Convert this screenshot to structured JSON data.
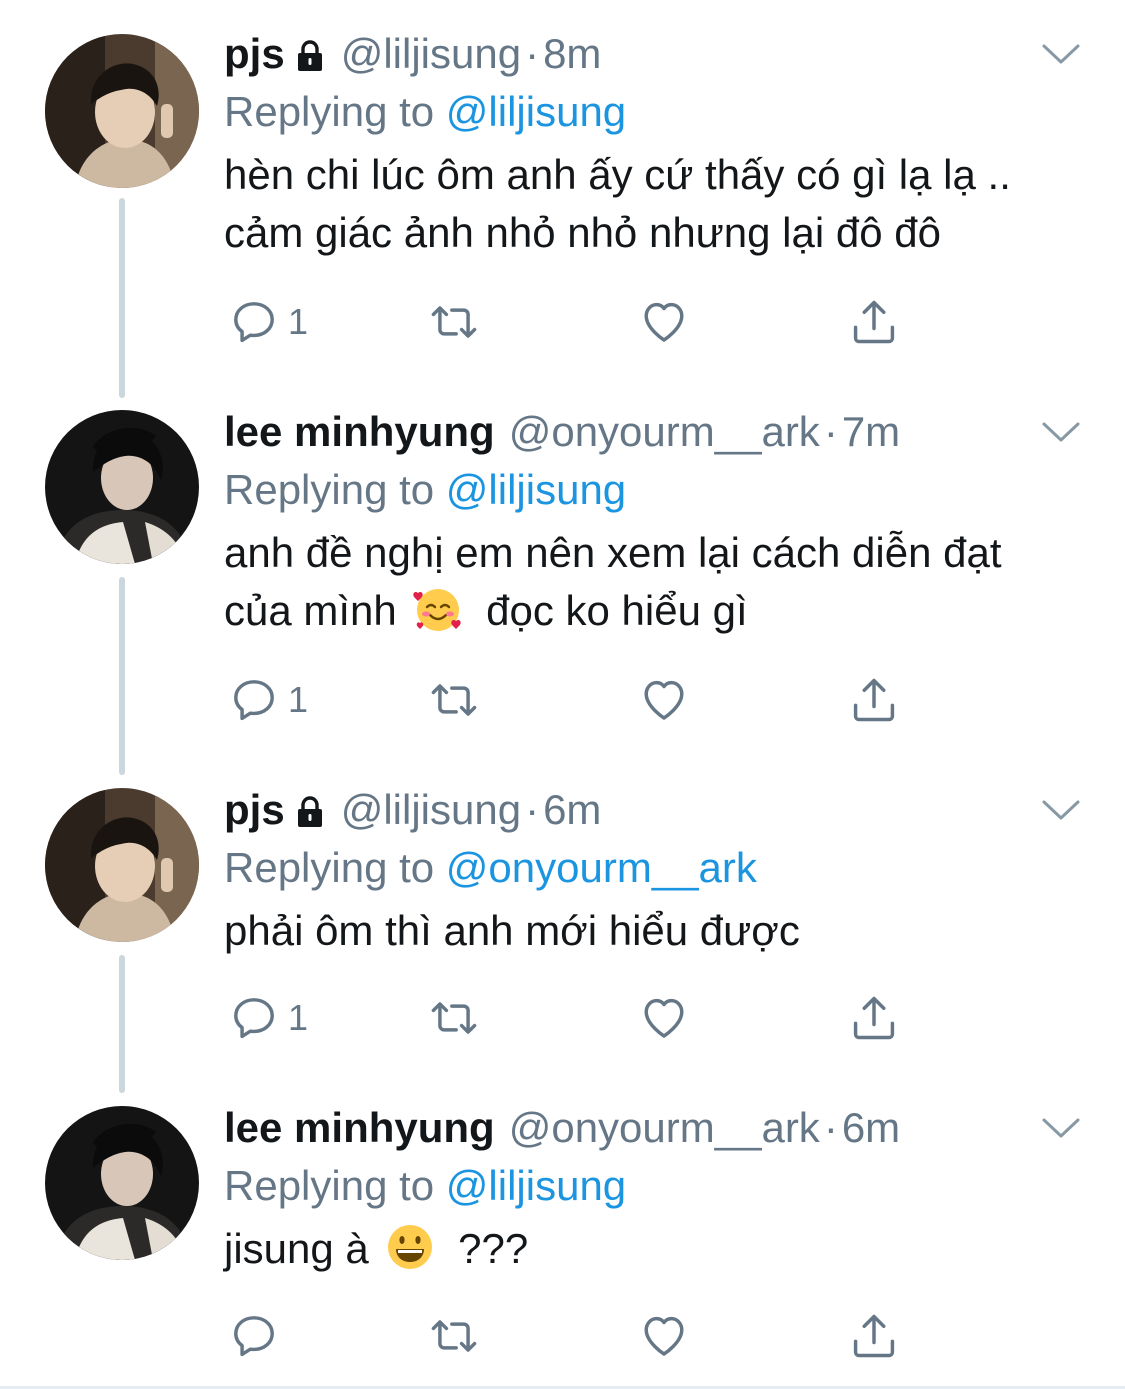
{
  "tweets": [
    {
      "name": "pjs",
      "protected": true,
      "handle": "@liljisung",
      "time": "8m",
      "replying_label": "Replying to",
      "replying_to": "@liljisung",
      "text_lines": [
        "hèn chi lúc ôm anh ấy cứ thấy có gì lạ lạ ..",
        "cảm giác ảnh nhỏ nhỏ nhưng lại đô đô"
      ],
      "reply_count": "1",
      "avatar": "avatar-pjs"
    },
    {
      "name": "lee minhyung",
      "protected": false,
      "handle": "@onyourm__ark",
      "time": "7m",
      "replying_label": "Replying to",
      "replying_to": "@liljisung",
      "text_line1": "anh đề nghị em nên xem lại cách diễn đạt",
      "text_line2_before": "của mình",
      "text_line2_emoji": "smiling-face-with-hearts",
      "text_line2_after": "đọc ko hiểu gì",
      "reply_count": "1",
      "avatar": "avatar-minhyung"
    },
    {
      "name": "pjs",
      "protected": true,
      "handle": "@liljisung",
      "time": "6m",
      "replying_label": "Replying to",
      "replying_to": "@onyourm__ark",
      "text_lines": [
        "phải ôm thì anh mới hiểu được"
      ],
      "reply_count": "1",
      "avatar": "avatar-pjs"
    },
    {
      "name": "lee minhyung",
      "protected": false,
      "handle": "@onyourm__ark",
      "time": "6m",
      "replying_label": "Replying to",
      "replying_to": "@liljisung",
      "text_before": "jisung à",
      "text_emoji": "grinning-face",
      "text_after": "???",
      "reply_count": "",
      "avatar": "avatar-minhyung"
    }
  ],
  "separator": "·",
  "colors": {
    "text": "#14171a",
    "secondary": "#657786",
    "link": "#1b95e0",
    "thread_line": "#ccd6dd",
    "icon": "#657786"
  },
  "icons": {
    "reply": "reply-icon",
    "retweet": "retweet-icon",
    "like": "heart-icon",
    "share": "share-icon",
    "more": "chevron-down-icon",
    "protected": "lock-icon"
  }
}
